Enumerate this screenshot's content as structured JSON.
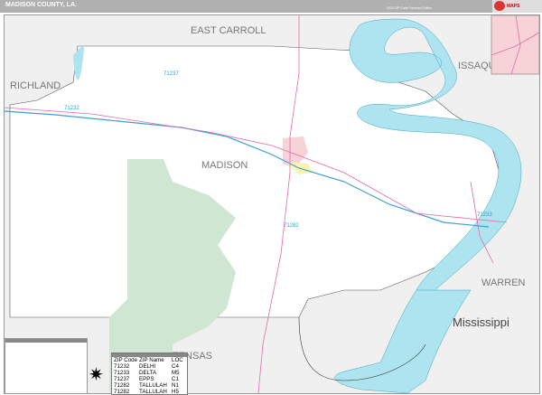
{
  "header": {
    "title": "MADISON COUNTY, LA.",
    "edition": "2020 ZIP Code Premium Edition",
    "logo_text": "MAPS"
  },
  "map": {
    "colors": {
      "county": "#ffffff",
      "outside": "#f0f0f0",
      "water": "#aee4ef",
      "river_edge": "#3aa8c0",
      "interstate": "#3aa0d8",
      "us_highway": "#e36aa8",
      "forest": "#cfe6d3",
      "city": "#f7d3d8",
      "county_line": "#333333"
    },
    "labels": {
      "east_carroll": "EAST CARROLL",
      "richland": "RICHLAND",
      "issaquena": "ISSAQU",
      "madison": "MADISON",
      "tensas": "TENSAS",
      "warren": "WARREN",
      "state": "Mississippi"
    },
    "zip_labels": [
      "71237",
      "71232",
      "71282",
      "71233"
    ]
  },
  "zip_table": {
    "headers": [
      "ZIP Code",
      "ZIP Name",
      "LOC"
    ],
    "rows": [
      {
        "zip": "71232",
        "name": "DELHI",
        "loc": "C4"
      },
      {
        "zip": "71233",
        "name": "DELTA",
        "loc": "M5"
      },
      {
        "zip": "71237",
        "name": "EPPS",
        "loc": "C1"
      },
      {
        "zip": "71282",
        "name": "TALLULAH",
        "loc": "N1"
      },
      {
        "zip": "71282",
        "name": "TALLULAH",
        "loc": "H5"
      }
    ]
  },
  "compass": {
    "icon": "compass-rose-icon"
  }
}
